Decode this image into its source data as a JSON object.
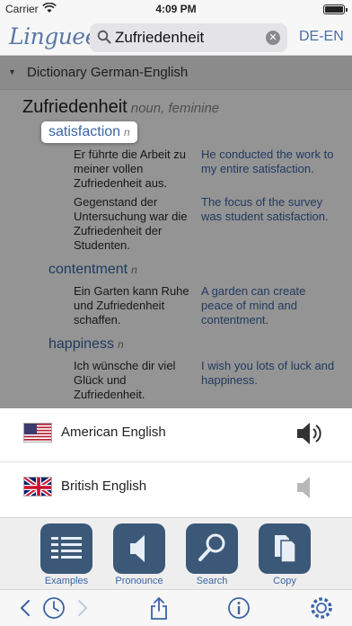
{
  "status_bar": {
    "carrier": "Carrier",
    "time": "4:09 PM"
  },
  "header": {
    "logo": "Linguee",
    "search_value": "Zufriedenheit",
    "lang_toggle": "DE-EN"
  },
  "dictionary": {
    "section_title": "Dictionary German-English",
    "headword": "Zufriedenheit",
    "headword_gram": "noun, feminine",
    "senses": [
      {
        "term": "satisfaction",
        "gram": "n",
        "examples": [
          {
            "src": "Er führte die Arbeit zu meiner vollen Zufriedenheit aus.",
            "dst": "He conducted the work to my entire satisfaction."
          },
          {
            "src": "Gegenstand der Untersuchung war die Zufriedenheit der Studenten.",
            "dst": "The focus of the survey was student satisfaction."
          }
        ]
      },
      {
        "term": "contentment",
        "gram": "n",
        "examples": [
          {
            "src": "Ein Garten kann Ruhe und Zufriedenheit schaffen.",
            "dst": "A garden can create peace of mind and contentment."
          }
        ]
      },
      {
        "term": "happiness",
        "gram": "n",
        "examples": [
          {
            "src": "Ich wünsche dir viel Glück und Zufriedenheit.",
            "dst": "I wish you lots of luck and happiness."
          }
        ]
      }
    ]
  },
  "pronounce_sheet": {
    "options": [
      {
        "label": "American English",
        "flag": "us-flag-icon",
        "speaker": "speaker-active-icon"
      },
      {
        "label": "British English",
        "flag": "uk-flag-icon",
        "speaker": "speaker-muted-icon"
      }
    ]
  },
  "toolbar": {
    "items": [
      {
        "label": "Examples",
        "icon": "list-icon"
      },
      {
        "label": "Pronounce",
        "icon": "speaker-icon"
      },
      {
        "label": "Search",
        "icon": "magnifier-icon"
      },
      {
        "label": "Copy",
        "icon": "copy-icon"
      }
    ]
  },
  "colors": {
    "accent": "#3a64a6",
    "tool_button": "#3b5878"
  }
}
